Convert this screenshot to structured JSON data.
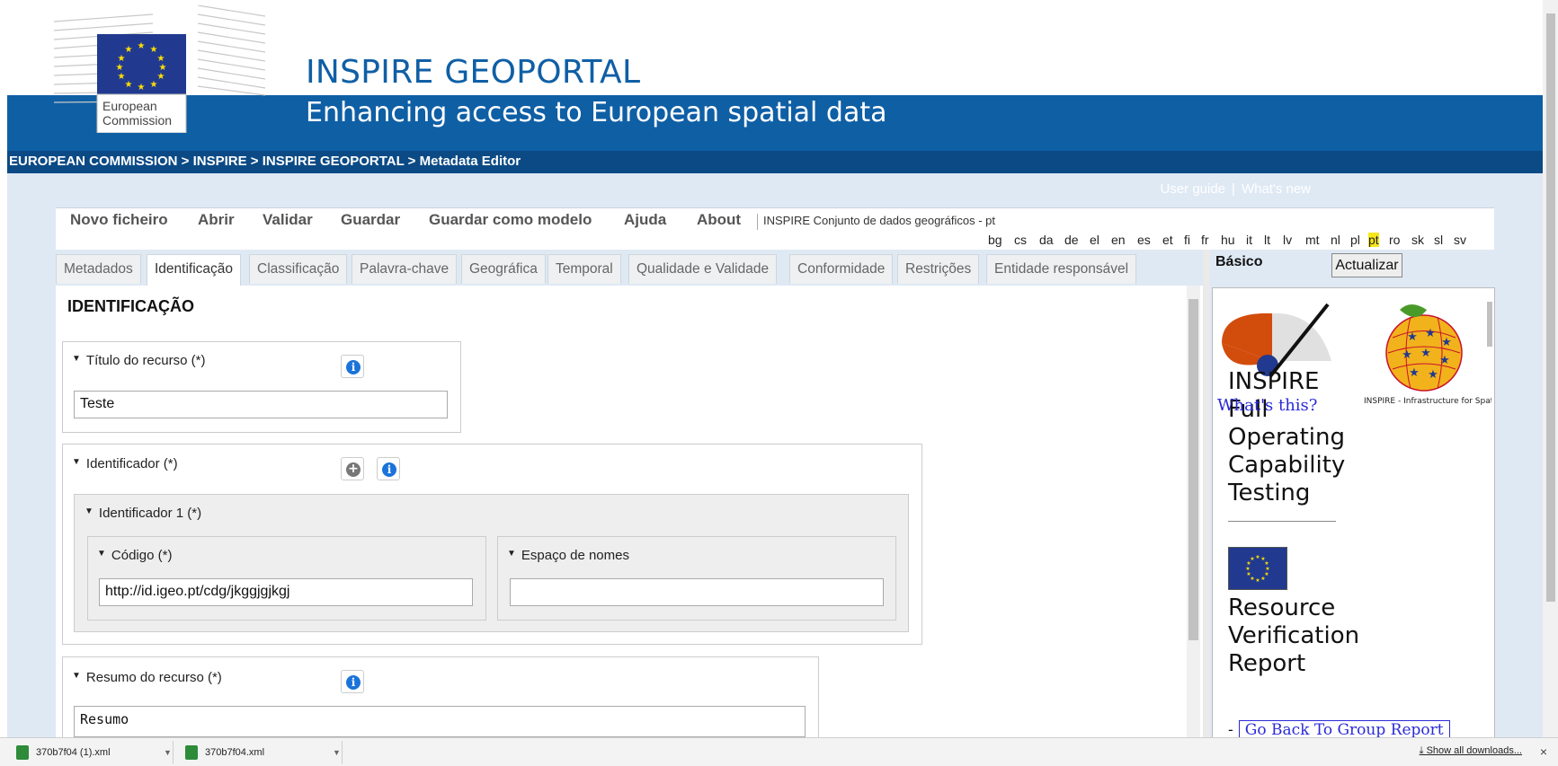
{
  "header": {
    "site_title": "INSPIRE GEOPORTAL",
    "site_subtitle": "Enhancing access to European spatial data",
    "logo_text_line1": "European",
    "logo_text_line2": "Commission",
    "breadcrumb": "EUROPEAN COMMISSION > INSPIRE > INSPIRE GEOPORTAL > Metadata Editor",
    "links": {
      "user_guide": "User guide",
      "separator": "|",
      "whats_new": "What's new"
    }
  },
  "toolbar": {
    "items": [
      "Novo ficheiro",
      "Abrir",
      "Validar",
      "Guardar",
      "Guardar como modelo",
      "Ajuda",
      "About"
    ],
    "doc_type": "INSPIRE Conjunto de dados geográficos - pt"
  },
  "languages": {
    "items": [
      "bg",
      "cs",
      "da",
      "de",
      "el",
      "en",
      "es",
      "et",
      "fi",
      "fr",
      "hu",
      "it",
      "lt",
      "lv",
      "mt",
      "nl",
      "pl",
      "pt",
      "ro",
      "sk",
      "sl",
      "sv"
    ],
    "active": "pt"
  },
  "tabs": [
    "Metadados",
    "Identificação",
    "Classificação",
    "Palavra-chave",
    "Geográfica",
    "Temporal",
    "Qualidade e Validade",
    "Conformidade",
    "Restrições",
    "Entidade responsável"
  ],
  "active_tab": "Identificação",
  "form": {
    "section_title": "IDENTIFICAÇÃO",
    "titulo": {
      "label": "Título do recurso (*)",
      "value": "Teste"
    },
    "identificador": {
      "label": "Identificador (*)"
    },
    "identificador1": {
      "label": "Identificador 1 (*)"
    },
    "codigo": {
      "label": "Código (*)",
      "value": "http://id.igeo.pt/cdg/jkggjgjkgj"
    },
    "espaco": {
      "label": "Espaço de nomes",
      "value": ""
    },
    "resumo": {
      "label": "Resumo do recurso (*)",
      "value": "Resumo"
    }
  },
  "right_panel": {
    "mode_label": "Básico",
    "refresh_button": "Actualizar",
    "foc_lines": [
      "INSPIRE",
      "Full",
      "Operating",
      "Capability",
      "Testing"
    ],
    "whats_this": "What's this?",
    "badge_text": "INSPIRE - Infrastructure for Spatial Information in Europe",
    "report_lines": [
      "Resource",
      "Verification",
      "Report"
    ],
    "go_back_prefix": "-",
    "go_back_link": "Go Back To Group Report"
  },
  "downloads": {
    "files": [
      "370b7f04 (1).xml",
      "370b7f04.xml"
    ],
    "show_all": "Show all downloads...",
    "close": "×"
  },
  "icons": [
    "info-icon",
    "add-icon",
    "collapse-triangle-icon",
    "xml-file-icon",
    "download-icon",
    "close-icon"
  ],
  "colors": {
    "banner_blue": "#0f5fa5",
    "breadcrumb_blue": "#0b4a85",
    "panel_bg": "#dfe9f4",
    "active_lang": "#f7e71a",
    "link_blue": "#2a2ad8"
  }
}
